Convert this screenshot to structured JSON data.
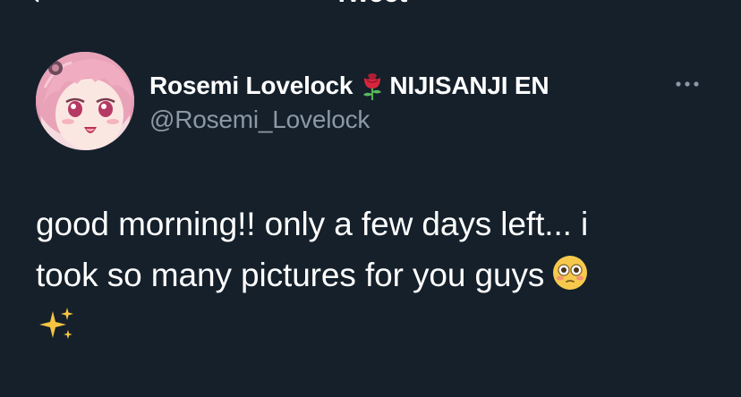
{
  "nav": {
    "title": "Tweet",
    "back_icon": "arrow-left-icon"
  },
  "author": {
    "name": "Rosemi Lovelock",
    "name_suffix": "NIJISANJI EN",
    "name_emoji": "rose-icon",
    "handle": "@Rosemi_Lovelock",
    "avatar": "avatar-pink-haired-anime-girl"
  },
  "more_icon": "more-horizontal-icon",
  "tweet": {
    "line1": "good morning!! only a few days left... i",
    "line2": "took so many pictures for you guys",
    "emoji_1": "flushed-face-icon",
    "emoji_2": "sparkles-icon"
  },
  "colors": {
    "background": "#15202b",
    "text_primary": "#ffffff",
    "text_secondary": "#8b98a5"
  }
}
